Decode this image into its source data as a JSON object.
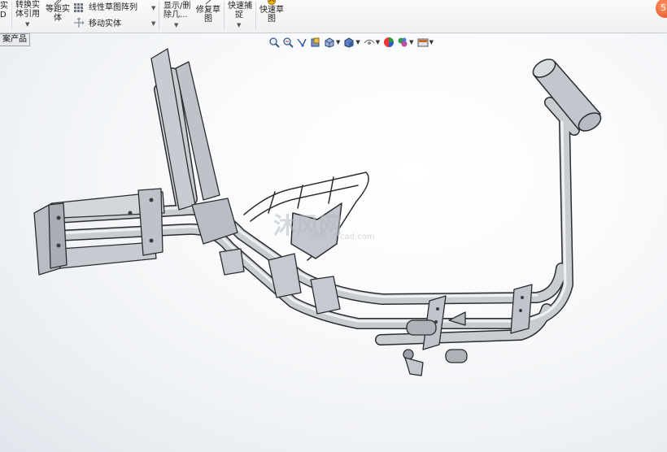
{
  "ribbon": {
    "frag_left_1": "实",
    "frag_left_2": "D",
    "convert_1": "转换实",
    "convert_2": "体引用",
    "equidistant_1": "等距实",
    "equidistant_2": "体",
    "linear_pattern": "线性草图阵列",
    "move_entity": "移动实体",
    "show_delete_1": "显示/删",
    "show_delete_2": "除几...",
    "repair_1": "修复草",
    "repair_2": "图",
    "quick_snap_1": "快速捕",
    "quick_snap_2": "捉",
    "quick_sketch_1": "快速草",
    "quick_sketch_2": "图"
  },
  "tree_tab": "案产品",
  "badge": "5",
  "heads_up_icons": [
    "zoom-to-fit-icon",
    "zoom-area-icon",
    "previous-view-icon",
    "section-view-icon",
    "view-orientation-icon",
    "display-style-icon",
    "hide-show-icon",
    "edit-appearance-icon",
    "apply-scene-icon",
    "view-settings-icon"
  ],
  "watermark": {
    "brand": "沐风网",
    "url": "www.mfcad.com"
  },
  "colors": {
    "accent_orange": "#e0461a",
    "tube_fill": "#c9ccd1",
    "tube_edge": "#2a2c30"
  }
}
